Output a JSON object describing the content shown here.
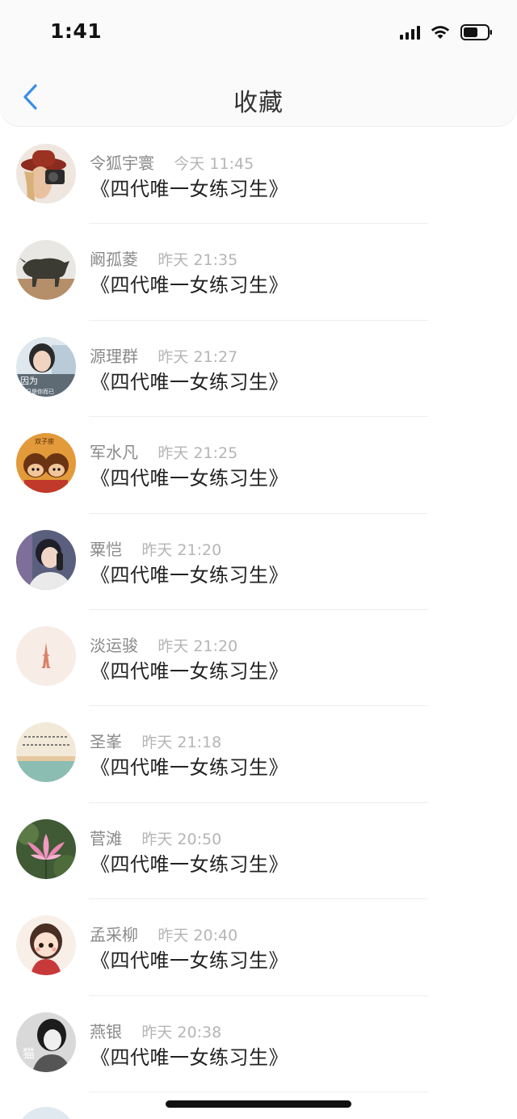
{
  "status_bar": {
    "time": "1:41"
  },
  "nav": {
    "title": "收藏",
    "back_icon": "chevron-left-icon",
    "accent": "#3a8ee6"
  },
  "items": [
    {
      "user": "令狐宇寰",
      "time": "今天 11:45",
      "message": "《四代唯一女练习生》",
      "avatar": "woman-hat-camera"
    },
    {
      "user": "阚孤菱",
      "time": "昨天 21:35",
      "message": "《四代唯一女练习生》",
      "avatar": "rhino-statue"
    },
    {
      "user": "源理群",
      "time": "昨天 21:27",
      "message": "《四代唯一女练习生》",
      "avatar": "girl-photo-text"
    },
    {
      "user": "军水凡",
      "time": "昨天 21:25",
      "message": "《四代唯一女练习生》",
      "avatar": "cartoon-couple"
    },
    {
      "user": "粟恺",
      "time": "昨天 21:20",
      "message": "《四代唯一女练习生》",
      "avatar": "singer-microphone"
    },
    {
      "user": "淡运骏",
      "time": "昨天 21:20",
      "message": "《四代唯一女练习生》",
      "avatar": "eiffel-tower"
    },
    {
      "user": "圣峯",
      "time": "昨天 21:18",
      "message": "《四代唯一女练习生》",
      "avatar": "sea-text"
    },
    {
      "user": "菅滩",
      "time": "昨天 20:50",
      "message": "《四代唯一女练习生》",
      "avatar": "lotus-flower"
    },
    {
      "user": "孟采柳",
      "time": "昨天 20:40",
      "message": "《四代唯一女练习生》",
      "avatar": "cartoon-girl"
    },
    {
      "user": "燕银",
      "time": "昨天 20:38",
      "message": "《四代唯一女练习生》",
      "avatar": "cat-girl-bw"
    }
  ]
}
